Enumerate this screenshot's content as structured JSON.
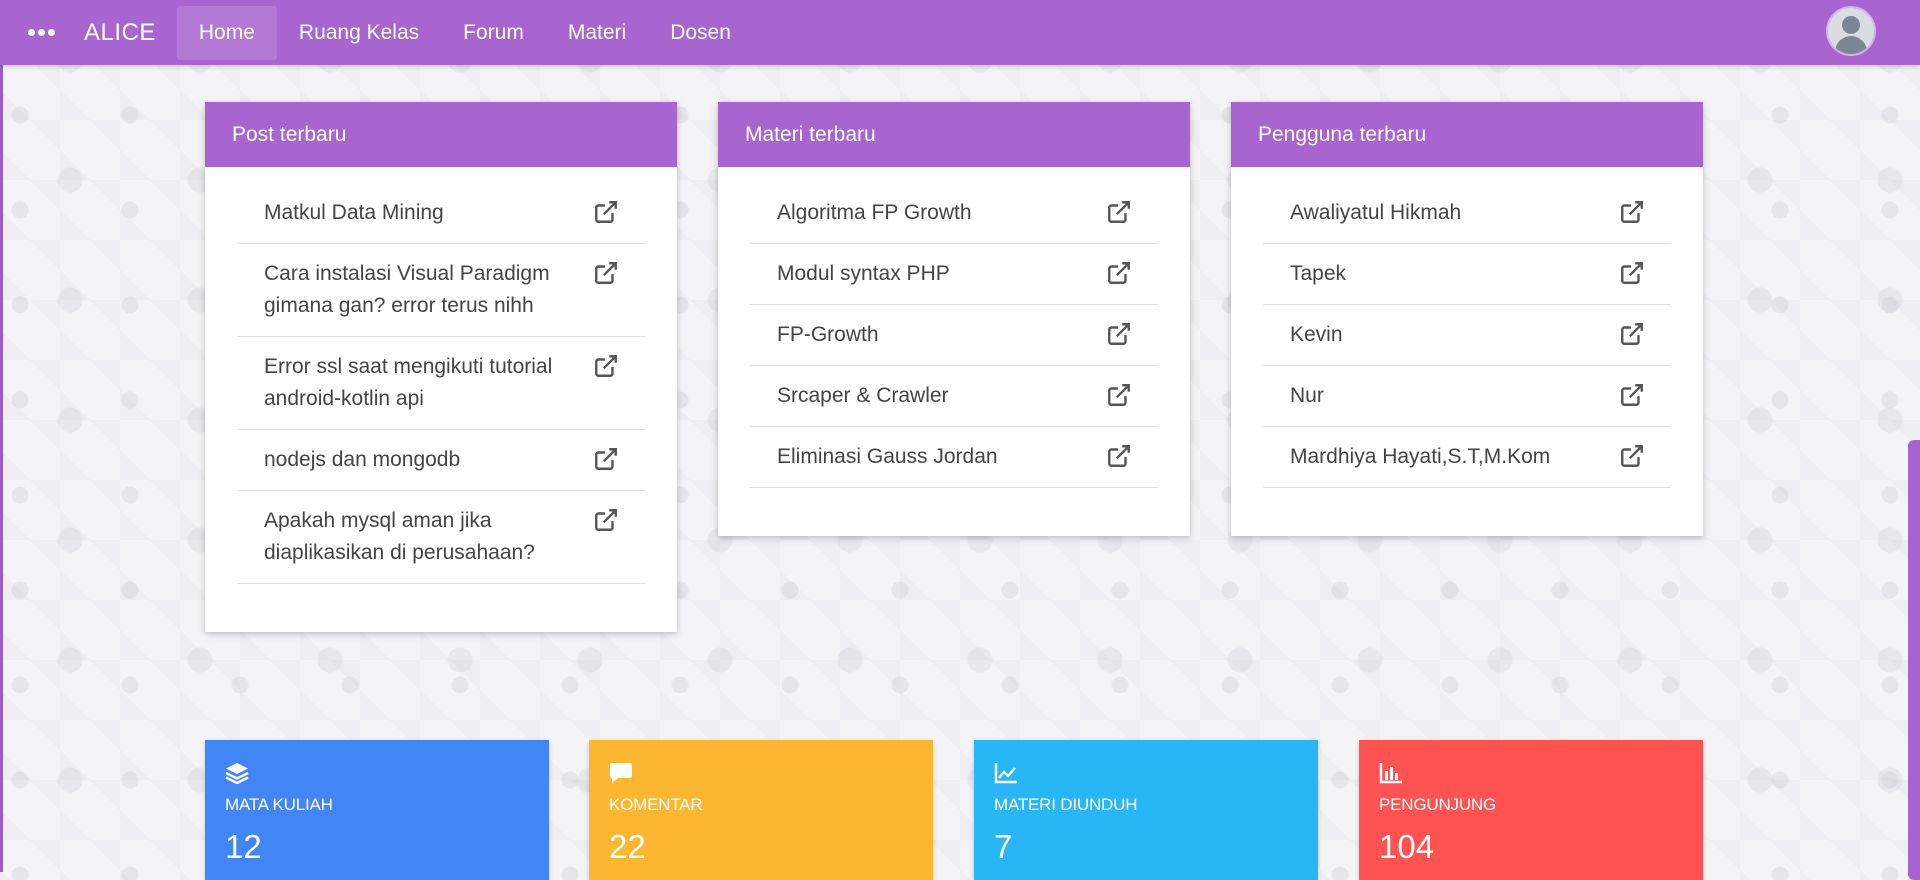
{
  "nav": {
    "brand": "ALICE",
    "links": [
      "Home",
      "Ruang Kelas",
      "Forum",
      "Materi",
      "Dosen"
    ]
  },
  "cards": {
    "posts": {
      "title": "Post terbaru",
      "items": [
        "Matkul Data Mining",
        "Cara instalasi Visual Paradigm gimana gan? error terus nihh",
        "Error ssl saat mengikuti tutorial android-kotlin api",
        "nodejs dan mongodb",
        "Apakah mysql aman jika diaplikasikan di perusahaan?"
      ]
    },
    "materi": {
      "title": "Materi terbaru",
      "items": [
        "Algoritma FP Growth",
        "Modul syntax PHP",
        "FP-Growth",
        "Srcaper & Crawler",
        "Eliminasi Gauss Jordan"
      ]
    },
    "pengguna": {
      "title": "Pengguna terbaru",
      "items": [
        "Awaliyatul Hikmah",
        "Tapek",
        "Kevin",
        "Nur",
        "Mardhiya Hayati,S.T,M.Kom"
      ]
    }
  },
  "stats": [
    {
      "label": "MATA KULIAH",
      "value": "12",
      "color": "#4285f4",
      "icon": "layers-icon"
    },
    {
      "label": "KOMENTAR",
      "value": "22",
      "color": "#fbb732",
      "icon": "comment-icon"
    },
    {
      "label": "MATERI DIUNDUH",
      "value": "7",
      "color": "#29b6f6",
      "icon": "area-chart-icon"
    },
    {
      "label": "PENGUNJUNG",
      "value": "104",
      "color": "#ff5252",
      "icon": "bar-chart-icon"
    }
  ],
  "colors": {
    "primary": "#a864cf"
  }
}
